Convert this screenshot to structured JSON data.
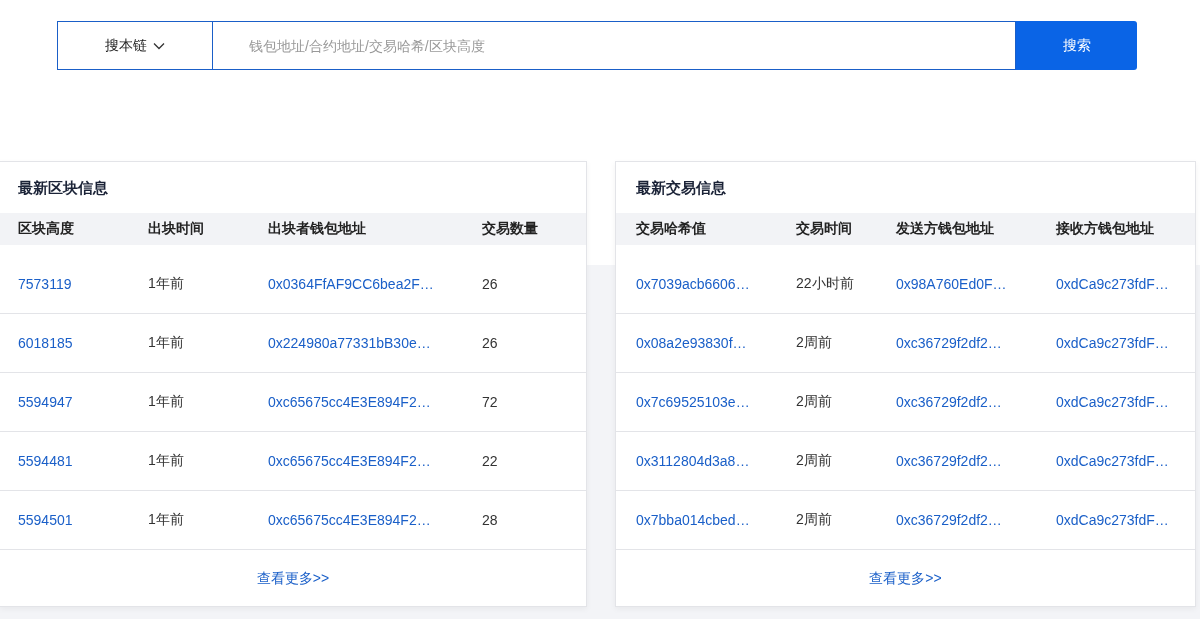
{
  "search": {
    "chain_selector": "搜本链",
    "placeholder": "钱包地址/合约地址/交易哈希/区块高度",
    "button": "搜索"
  },
  "panels": [
    {
      "title": "最新区块信息",
      "columns": [
        {
          "label": "区块高度",
          "kind": "link"
        },
        {
          "label": "出块时间",
          "kind": "text"
        },
        {
          "label": "出块者钱包地址",
          "kind": "link"
        },
        {
          "label": "交易数量",
          "kind": "text"
        }
      ],
      "rows": [
        [
          "7573119",
          "1年前",
          "0x0364FfAF9CC6bea2F…",
          "26"
        ],
        [
          "6018185",
          "1年前",
          "0x224980a77331bB30e…",
          "26"
        ],
        [
          "5594947",
          "1年前",
          "0xc65675cc4E3E894F2…",
          "72"
        ],
        [
          "5594481",
          "1年前",
          "0xc65675cc4E3E894F2…",
          "22"
        ],
        [
          "5594501",
          "1年前",
          "0xc65675cc4E3E894F2…",
          "28"
        ]
      ],
      "more": "查看更多>>"
    },
    {
      "title": "最新交易信息",
      "columns": [
        {
          "label": "交易哈希值",
          "kind": "link"
        },
        {
          "label": "交易时间",
          "kind": "text"
        },
        {
          "label": "发送方钱包地址",
          "kind": "link"
        },
        {
          "label": "接收方钱包地址",
          "kind": "link"
        }
      ],
      "rows": [
        [
          "0x7039acb6606…",
          "22小时前",
          "0x98A760Ed0F…",
          "0xdCa9c273fdF…"
        ],
        [
          "0x08a2e93830f…",
          "2周前",
          "0xc36729f2df2…",
          "0xdCa9c273fdF…"
        ],
        [
          "0x7c69525103e…",
          "2周前",
          "0xc36729f2df2…",
          "0xdCa9c273fdF…"
        ],
        [
          "0x3112804d3a8…",
          "2周前",
          "0xc36729f2df2…",
          "0xdCa9c273fdF…"
        ],
        [
          "0x7bba014cbed…",
          "2周前",
          "0xc36729f2df2…",
          "0xdCa9c273fdF…"
        ]
      ],
      "more": "查看更多>>"
    }
  ]
}
